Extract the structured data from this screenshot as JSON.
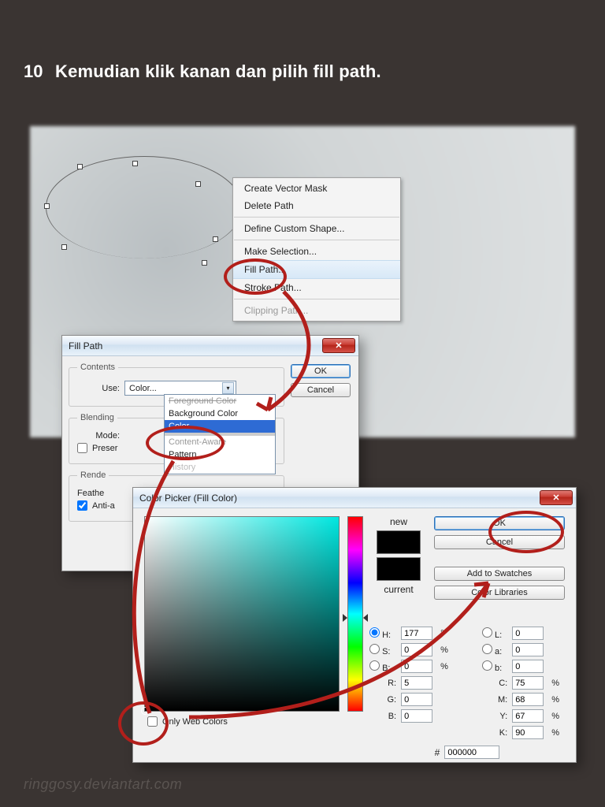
{
  "step_number": "10",
  "instruction": "Kemudian klik kanan dan pilih fill path.",
  "watermark": "ringgosy.deviantart.com",
  "context_menu": {
    "create_vector_mask": "Create Vector Mask",
    "delete_path": "Delete Path",
    "define_custom_shape": "Define Custom Shape...",
    "make_selection": "Make Selection...",
    "fill_path": "Fill Path...",
    "stroke_path": "Stroke Path...",
    "clipping_path": "Clipping Path..."
  },
  "fill_path_dialog": {
    "title": "Fill Path",
    "ok": "OK",
    "cancel": "Cancel",
    "contents_legend": "Contents",
    "use_label": "Use:",
    "use_value": "Color...",
    "dropdown": {
      "foreground": "Foreground Color",
      "background": "Background Color",
      "color": "Color...",
      "content_aware": "Content-Aware",
      "pattern": "Pattern",
      "history": "History"
    },
    "blending_legend": "Blending",
    "mode_label": "Mode:",
    "preserve": "Preserve Transparency",
    "rendering_legend": "Rendering",
    "feather_label": "Feather Radius:",
    "antialias": "Anti-alias"
  },
  "color_picker": {
    "title": "Color Picker (Fill Color)",
    "new_label": "new",
    "current_label": "current",
    "ok": "OK",
    "cancel": "Cancel",
    "add_swatch": "Add to Swatches",
    "color_libs": "Color Libraries",
    "only_web": "Only Web Colors",
    "hex_prefix": "#",
    "hex": "000000",
    "H_label": "H:",
    "H_val": "177",
    "H_unit": "°",
    "S_label": "S:",
    "S_val": "0",
    "S_unit": "%",
    "Bv_label": "B:",
    "Bv_val": "0",
    "Bv_unit": "%",
    "R_label": "R:",
    "R_val": "5",
    "G_label": "G:",
    "G_val": "0",
    "B_label": "B:",
    "B_val": "0",
    "L_label": "L:",
    "L_val": "0",
    "a_label": "a:",
    "a_val": "0",
    "b_label": "b:",
    "b_val": "0",
    "C_label": "C:",
    "C_val": "75",
    "C_unit": "%",
    "M_label": "M:",
    "M_val": "68",
    "M_unit": "%",
    "Y_label": "Y:",
    "Y_val": "67",
    "Y_unit": "%",
    "K_label": "K:",
    "K_val": "90",
    "K_unit": "%"
  }
}
